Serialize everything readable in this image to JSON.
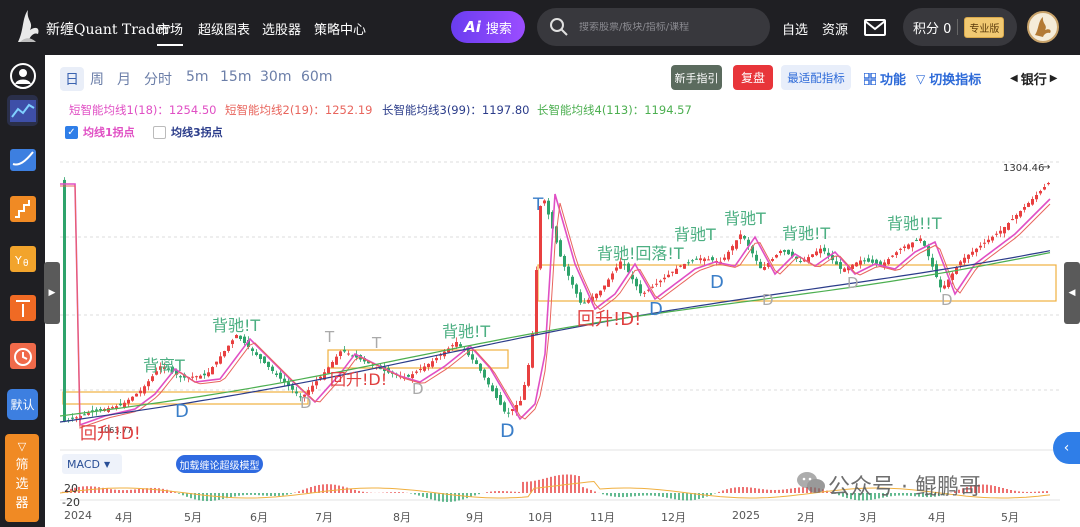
{
  "header": {
    "brand": "新缠Quant Trader",
    "nav": [
      "市场",
      "超级图表",
      "选股器",
      "策略中心"
    ],
    "ai_search_label": "搜索",
    "search_placeholder": "搜索股票/板块/指标/课程",
    "links": [
      "自选",
      "资源"
    ],
    "points_label": "积分 0",
    "pro_badge": "专业版"
  },
  "sidebar": {
    "icons": [
      "user-icon",
      "line-chart-icon",
      "trend-chart-icon",
      "stairs-chart-icon",
      "indicator-icon",
      "top-icon",
      "clock-icon"
    ],
    "default_label": "默认",
    "filter_label": [
      "筛",
      "选",
      "器"
    ]
  },
  "toolbar": {
    "periods": [
      "日",
      "周",
      "月",
      "分时",
      "5m",
      "15m",
      "30m",
      "60m"
    ],
    "active_period": "日",
    "newbie_button": "新手指引",
    "replay_button": "复盘",
    "best_indicator_button": "最适配指标",
    "function_label": "功能",
    "switch_indicator_label": "切换指标",
    "bank_label": "银行"
  },
  "indicators": {
    "ma1": "短智能均线1(18)：1254.50",
    "ma2": "短智能均线2(19)：1252.19",
    "ma3": "长智能均线3(99)：1197.80",
    "ma4": "长智能均线4(113)：1194.57",
    "ma1_color": "#e04fc4",
    "ma2_color": "#e8655d",
    "ma3_color": "#2b3c8a",
    "ma4_color": "#4caf50"
  },
  "checkboxes": {
    "turn1": {
      "label": "均线1拐点",
      "checked": true
    },
    "turn3": {
      "label": "均线3拐点",
      "checked": false
    }
  },
  "chart_annotations": {
    "high_label": "1304.46",
    "low_label": "1063.77",
    "signals": [
      "回升!D!",
      "背离T",
      "D",
      "背驰!T",
      "T",
      "回升!D!",
      "T",
      "D",
      "D",
      "背驰!T",
      "D",
      "T",
      "回升!D!",
      "背驰!回落!T",
      "D",
      "背驰T",
      "D",
      "背驰T",
      "D",
      "背驰!T",
      "D",
      "背驰!!T",
      "D"
    ]
  },
  "bottom": {
    "macd_label": "MACD",
    "load_button": "加载缠论超级模型",
    "macd_ticks": [
      "20",
      "-20"
    ],
    "months": [
      "2024",
      "4月",
      "5月",
      "6月",
      "7月",
      "8月",
      "9月",
      "10月",
      "11月",
      "12月",
      "2025",
      "2月",
      "3月",
      "4月",
      "5月"
    ]
  },
  "watermark": "公众号 · 鲲鹏哥"
}
